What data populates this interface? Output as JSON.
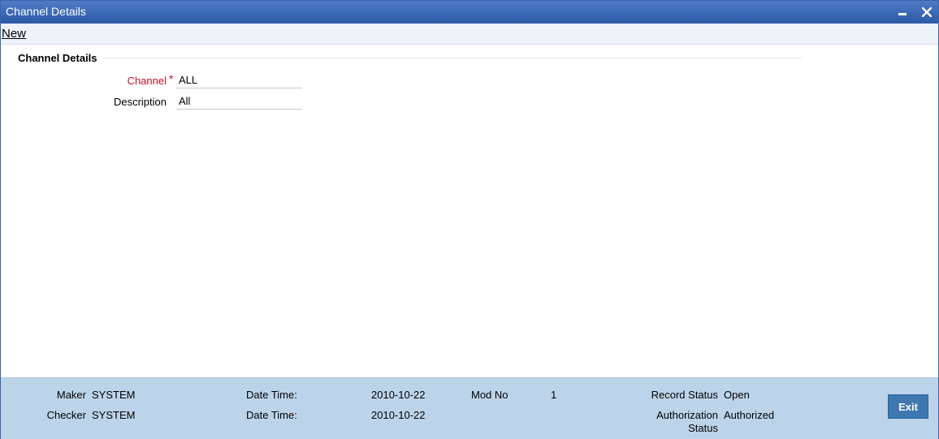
{
  "window": {
    "title": "Channel Details"
  },
  "toolbar": {
    "new_label": "New"
  },
  "section": {
    "title": "Channel Details"
  },
  "form": {
    "channel_label": "Channel",
    "required_mark": "*",
    "channel_value": "ALL",
    "description_label": "Description",
    "description_value": "All"
  },
  "footer": {
    "maker_label": "Maker",
    "maker_value": "SYSTEM",
    "checker_label": "Checker",
    "checker_value": "SYSTEM",
    "maker_datetime_label": "Date Time:",
    "maker_datetime_value": "2010-10-22",
    "checker_datetime_label": "Date Time:",
    "checker_datetime_value": "2010-10-22",
    "mod_no_label": "Mod No",
    "mod_no_value": "1",
    "record_status_label": "Record Status",
    "record_status_value": "Open",
    "auth_status_label_line1": "Authorization",
    "auth_status_label_line2": "Status",
    "auth_status_value": "Authorized",
    "exit_label": "Exit"
  }
}
